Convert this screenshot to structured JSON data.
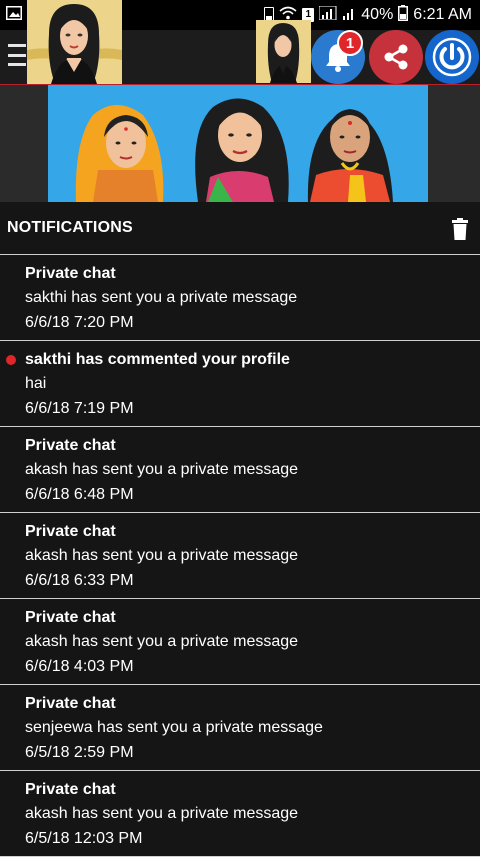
{
  "status_bar": {
    "battery": "40%",
    "time": "6:21 AM",
    "sim": "1"
  },
  "app_bar": {
    "notification_count": "1"
  },
  "notifications": {
    "title": "NOTIFICATIONS",
    "items": [
      {
        "title": "Private chat",
        "body": "sakthi has sent you a private message",
        "time": "6/6/18 7:20 PM",
        "unread": false
      },
      {
        "title": "sakthi has commented your profile",
        "body": "hai",
        "time": "6/6/18 7:19 PM",
        "unread": true
      },
      {
        "title": "Private chat",
        "body": "akash has sent you a private message",
        "time": "6/6/18 6:48 PM",
        "unread": false
      },
      {
        "title": "Private chat",
        "body": "akash has sent you a private message",
        "time": "6/6/18 6:33 PM",
        "unread": false
      },
      {
        "title": "Private chat",
        "body": "akash has sent you a private message",
        "time": "6/6/18 4:03 PM",
        "unread": false
      },
      {
        "title": "Private chat",
        "body": "senjeewa has sent you a private message",
        "time": "6/5/18 2:59 PM",
        "unread": false
      },
      {
        "title": "Private chat",
        "body": "akash has sent you a private message",
        "time": "6/5/18 12:03 PM",
        "unread": false
      }
    ]
  },
  "colors": {
    "accent_red": "#b8222c",
    "unread_dot": "#e0252b",
    "notification_button": "#2a7bcf",
    "share_button": "#c5323c",
    "power_button": "#1466cc"
  }
}
